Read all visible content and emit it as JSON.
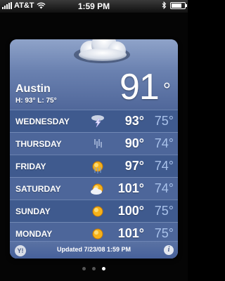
{
  "status_bar": {
    "carrier": "AT&T",
    "time": "1:59 PM",
    "battery_level": 0.8
  },
  "weather": {
    "city": "Austin",
    "hilo": "H: 93° L: 75°",
    "current_temp": "91",
    "degree_symbol": "°",
    "header_icon": "cloudy-icon",
    "forecast": [
      {
        "day": "WEDNESDAY",
        "hi": "93°",
        "lo": "75°",
        "icon": "thunderstorm-icon"
      },
      {
        "day": "THURSDAY",
        "hi": "90°",
        "lo": "74°",
        "icon": "rain-icon"
      },
      {
        "day": "FRIDAY",
        "hi": "97°",
        "lo": "74°",
        "icon": "sun-rain-icon"
      },
      {
        "day": "SATURDAY",
        "hi": "101°",
        "lo": "74°",
        "icon": "partly-cloudy-icon"
      },
      {
        "day": "SUNDAY",
        "hi": "100°",
        "lo": "75°",
        "icon": "sun-icon"
      },
      {
        "day": "MONDAY",
        "hi": "101°",
        "lo": "75°",
        "icon": "sun-icon"
      }
    ],
    "footer": {
      "yahoo": "Y!",
      "updated": "Updated 7/23/08 1:59 PM",
      "info": "i"
    }
  },
  "pager": {
    "count": 3,
    "active": 2
  },
  "colors": {
    "card_bg": "#4f6899",
    "low_temp": "#a9c2ea",
    "header_top": "#8fa3c9"
  }
}
